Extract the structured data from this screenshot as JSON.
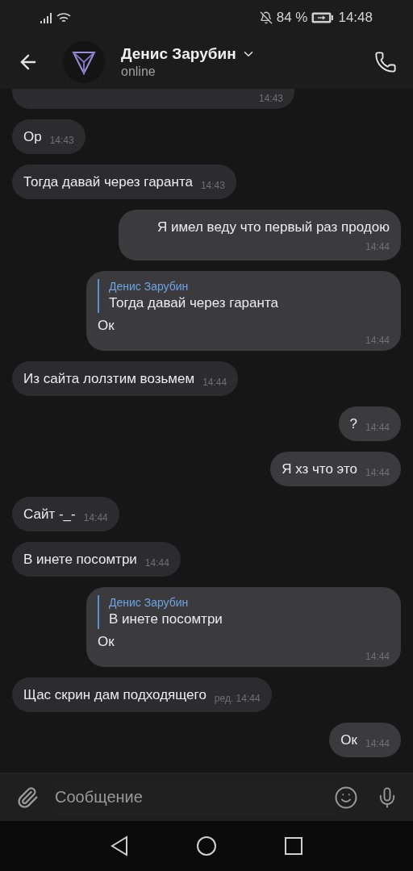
{
  "status_bar": {
    "battery": "84 %",
    "time": "14:48"
  },
  "header": {
    "name": "Денис Зарубин",
    "status": "online"
  },
  "messages": [
    {
      "kind": "incoming",
      "time": "14:43"
    },
    {
      "kind": "incoming",
      "text": "Ор",
      "time": "14:43"
    },
    {
      "kind": "incoming",
      "text": "Тогда давай через гаранта",
      "time": "14:43"
    },
    {
      "kind": "outgoing",
      "text": "Я имел веду что первый раз продою",
      "time": "14:44"
    },
    {
      "kind": "outgoing",
      "reply": {
        "author": "Денис Зарубин",
        "text": "Тогда давай через гаранта"
      },
      "text": "Ок",
      "time": "14:44"
    },
    {
      "kind": "incoming",
      "text": "Из сайта лолзтим возьмем",
      "time": "14:44"
    },
    {
      "kind": "outgoing",
      "text": "?",
      "time": "14:44"
    },
    {
      "kind": "outgoing",
      "text": "Я хз что это",
      "time": "14:44"
    },
    {
      "kind": "incoming",
      "text": "Сайт -_-",
      "time": "14:44"
    },
    {
      "kind": "incoming",
      "text": "В инете посомтри",
      "time": "14:44"
    },
    {
      "kind": "outgoing",
      "reply": {
        "author": "Денис Зарубин",
        "text": "В инете посомтри"
      },
      "text": "Ок",
      "time": "14:44"
    },
    {
      "kind": "incoming",
      "text": "Щас скрин дам подходящего",
      "time": "ред. 14:44"
    },
    {
      "kind": "outgoing",
      "text": "Ок",
      "time": "14:44"
    }
  ],
  "composer": {
    "placeholder": "Сообщение"
  }
}
